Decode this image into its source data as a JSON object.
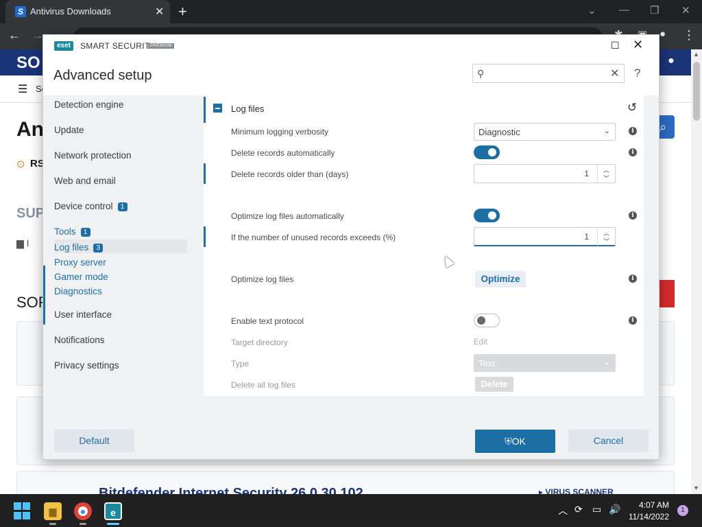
{
  "browser": {
    "tab_title": "Antivirus Downloads",
    "tab_favicon": "S",
    "new_tab": "+",
    "close_tab": "✕"
  },
  "site": {
    "logo": "SO",
    "nav_text": "Se",
    "heading": "An",
    "rss_label": "RS",
    "section_sup": "SUP",
    "folder_label": "I",
    "section_sor": "SOR",
    "product_title": "Bitdefender Internet Security 26.0.30.102",
    "virus_scanner": "VIRUS SCANNER"
  },
  "dialog": {
    "logo": "eset",
    "app_name": "SMART SECURITY",
    "edition": "PREMIUM",
    "title": "Advanced setup",
    "search_placeholder": ""
  },
  "sidebar": {
    "items": [
      {
        "label": "Detection engine"
      },
      {
        "label": "Update"
      },
      {
        "label": "Network protection"
      },
      {
        "label": "Web and email"
      },
      {
        "label": "Device control",
        "badge": "1"
      },
      {
        "label": "Tools",
        "badge": "1"
      },
      {
        "label": "Log files",
        "badge": "3"
      },
      {
        "label": "Proxy server"
      },
      {
        "label": "Gamer mode"
      },
      {
        "label": "Diagnostics"
      },
      {
        "label": "User interface"
      },
      {
        "label": "Notifications"
      },
      {
        "label": "Privacy settings"
      }
    ]
  },
  "section": {
    "title": "Log files",
    "rows": {
      "verbosity": {
        "label": "Minimum logging verbosity",
        "value": "Diagnostic"
      },
      "delete_auto": {
        "label": "Delete records automatically",
        "state": "on"
      },
      "older_than": {
        "label": "Delete records older than (days)",
        "value": "1"
      },
      "optimize_auto": {
        "label": "Optimize log files automatically",
        "state": "on"
      },
      "unused": {
        "label": "If the number of unused records exceeds (%)",
        "value": "1"
      },
      "optimize": {
        "label": "Optimize log files",
        "button": "Optimize"
      },
      "text_protocol": {
        "label": "Enable text protocol",
        "state": "off"
      },
      "target_dir": {
        "label": "Target directory",
        "link": "Edit"
      },
      "type": {
        "label": "Type",
        "value": "Text"
      },
      "delete_all": {
        "label": "Delete all log files",
        "button": "Delete"
      }
    }
  },
  "footer": {
    "default": "Default",
    "ok": "OK",
    "cancel": "Cancel"
  },
  "taskbar": {
    "time": "4:07 AM",
    "date": "11/14/2022",
    "notifications": "1"
  },
  "colors": {
    "accent": "#1d6ea4",
    "eset_brand": "#1b8a9e",
    "site_header": "#1a3478"
  }
}
